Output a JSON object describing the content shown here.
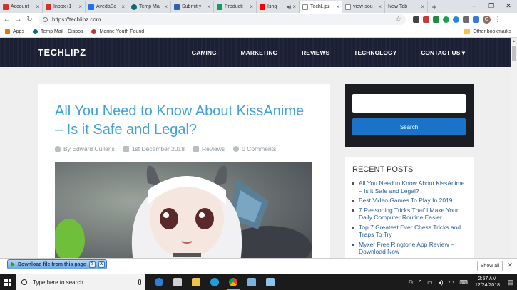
{
  "browser": {
    "tabs": [
      {
        "label": "Account",
        "color": "#d93025"
      },
      {
        "label": "Inbox (1",
        "color": "#d93025"
      },
      {
        "label": "AvedaSc",
        "color": "#1a73e8"
      },
      {
        "label": "Temp Ma",
        "color": "#0b6e6e"
      },
      {
        "label": "Submit y",
        "color": "#2f5fb3"
      },
      {
        "label": "Producti",
        "color": "#0f9d58"
      },
      {
        "label": "Ishq",
        "color": "#ff0000"
      },
      {
        "label": "TechLipz",
        "color": "#888888"
      },
      {
        "label": "view-sou",
        "color": "#888888"
      },
      {
        "label": "New Tab",
        "color": "#888888"
      }
    ],
    "active_tab_index": 7,
    "new_tab_symbol": "+",
    "url": "https://techlipz.com",
    "bookmarks": [
      {
        "label": "Apps",
        "color": "#e8710a"
      },
      {
        "label": "Temp Mail - Dispos",
        "color": "#0b6e6e"
      },
      {
        "label": "Marine Youth Found",
        "color": "#c0392b"
      }
    ],
    "other_bookmarks": "Other bookmarks",
    "profile_initial": "G"
  },
  "site": {
    "brand": "TECHLIPZ",
    "nav": [
      "GAMING",
      "MARKETING",
      "REVIEWS",
      "TECHNOLOGY",
      "CONTACT US ▾"
    ]
  },
  "article": {
    "title": "All You Need to Know About KissAnime – Is it Safe and Legal?",
    "author": "By Edward Cullens",
    "date": "1st December 2018",
    "category": "Reviews",
    "comments": "0 Comments"
  },
  "sidebar": {
    "search_placeholder": "",
    "search_button": "Search",
    "recent_title": "RECENT POSTS",
    "recent_posts": [
      "All You Need to Know About KissAnime – Is it Safe and Legal?",
      "Best Video Games To Play In 2019",
      "7 Reasoning Tricks That’ll Make Your Daily Computer Routine Easier",
      "Top 7 Greatest Ever Chess Tricks and Traps To Try",
      "Myxer Free Ringtone App Review – Download Now"
    ]
  },
  "download_bar": {
    "button_label": "Download file from this page",
    "help": "?",
    "close": "X",
    "show_all": "Show all",
    "close_bar": "✕"
  },
  "taskbar": {
    "search_placeholder": "Type here to search",
    "time": "2:57 AM",
    "date": "12/24/2018"
  }
}
